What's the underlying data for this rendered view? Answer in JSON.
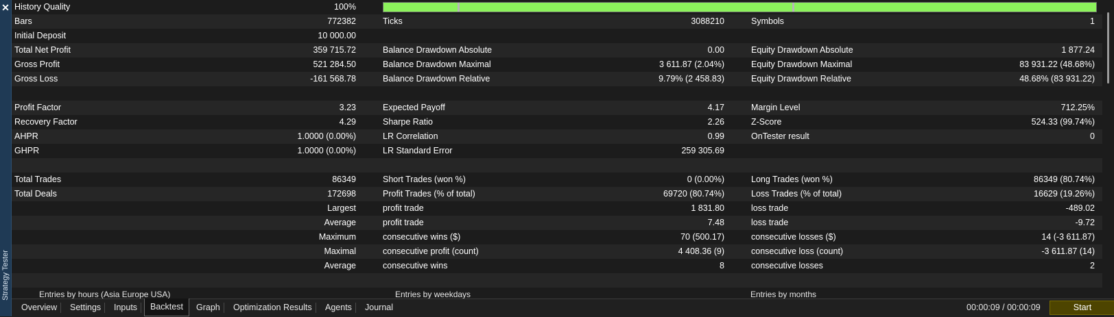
{
  "window": {
    "side_title": "Strategy Tester",
    "close_icon": "close-icon"
  },
  "report": {
    "history_quality": {
      "label": "History Quality",
      "value": "100%",
      "fraction": 1.0
    },
    "rows": [
      [
        "Bars",
        "772382",
        "Ticks",
        "3088210",
        "Symbols",
        "1"
      ],
      [
        "Initial Deposit",
        "10 000.00",
        "",
        "",
        "",
        ""
      ],
      [
        "Total Net Profit",
        "359 715.72",
        "Balance Drawdown Absolute",
        "0.00",
        "Equity Drawdown Absolute",
        "1 877.24"
      ],
      [
        "Gross Profit",
        "521 284.50",
        "Balance Drawdown Maximal",
        "3 611.87 (2.04%)",
        "Equity Drawdown Maximal",
        "83 931.22 (48.68%)"
      ],
      [
        "Gross Loss",
        "-161 568.78",
        "Balance Drawdown Relative",
        "9.79% (2 458.83)",
        "Equity Drawdown Relative",
        "48.68% (83 931.22)"
      ],
      [
        "",
        "",
        "",
        "",
        "",
        ""
      ],
      [
        "Profit Factor",
        "3.23",
        "Expected Payoff",
        "4.17",
        "Margin Level",
        "712.25%"
      ],
      [
        "Recovery Factor",
        "4.29",
        "Sharpe Ratio",
        "2.26",
        "Z-Score",
        "524.33 (99.74%)"
      ],
      [
        "AHPR",
        "1.0000 (0.00%)",
        "LR Correlation",
        "0.99",
        "OnTester result",
        "0"
      ],
      [
        "GHPR",
        "1.0000 (0.00%)",
        "LR Standard Error",
        "259 305.69",
        "",
        ""
      ],
      [
        "",
        "",
        "",
        "",
        "",
        ""
      ],
      [
        "Total Trades",
        "86349",
        "Short Trades (won %)",
        "0 (0.00%)",
        "Long Trades (won %)",
        "86349 (80.74%)"
      ],
      [
        "Total Deals",
        "172698",
        "Profit Trades (% of total)",
        "69720 (80.74%)",
        "Loss Trades (% of total)",
        "16629 (19.26%)"
      ],
      [
        "",
        "Largest",
        "profit trade",
        "1 831.80",
        "loss trade",
        "-489.02"
      ],
      [
        "",
        "Average",
        "profit trade",
        "7.48",
        "loss trade",
        "-9.72"
      ],
      [
        "",
        "Maximum",
        "consecutive wins ($)",
        "70 (500.17)",
        "consecutive losses ($)",
        "14 (-3 611.87)"
      ],
      [
        "",
        "Maximal",
        "consecutive profit (count)",
        "4 408.36 (9)",
        "consecutive loss (count)",
        "-3 611.87 (14)"
      ],
      [
        "",
        "Average",
        "consecutive wins",
        "8",
        "consecutive losses",
        "2"
      ],
      [
        "",
        "",
        "",
        "",
        "",
        ""
      ]
    ],
    "subheaders": [
      "Entries by hours (Asia Europe USA)",
      "Entries by weekdays",
      "Entries by months"
    ]
  },
  "tabs": [
    {
      "label": "Overview"
    },
    {
      "label": "Settings"
    },
    {
      "label": "Inputs"
    },
    {
      "label": "Backtest",
      "active": true
    },
    {
      "label": "Graph"
    },
    {
      "label": "Optimization Results"
    },
    {
      "label": "Agents"
    },
    {
      "label": "Journal"
    }
  ],
  "status": {
    "timer": "00:00:09 / 00:00:09",
    "start_label": "Start"
  },
  "colors": {
    "quality_bar": "#8cf25c",
    "start_button": "#4d4400",
    "side_panel": "#1f3a55"
  }
}
